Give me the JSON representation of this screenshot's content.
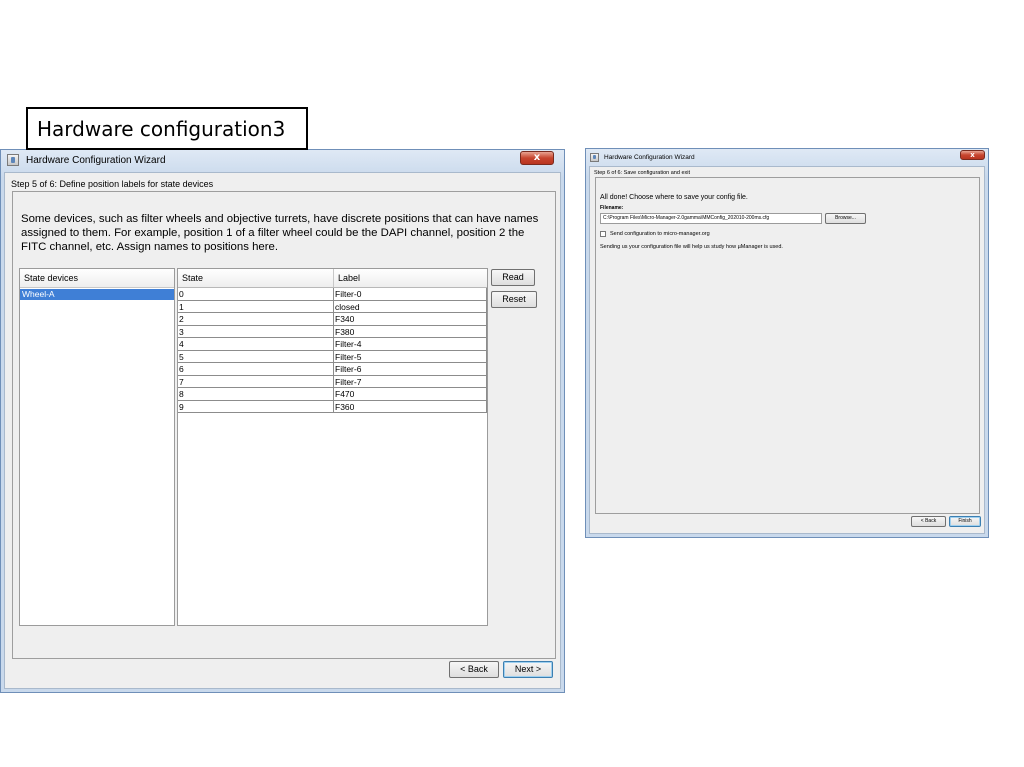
{
  "slide": {
    "title": "Hardware configuration3"
  },
  "left_window": {
    "title": "Hardware Configuration Wizard",
    "close_label": "x",
    "step_label": "Step 5 of 6: Define position labels for state devices",
    "description": "Some devices, such as filter wheels and objective turrets, have discrete positions that can have names assigned to them. For example, position 1 of a filter wheel could be the DAPI channel, position 2 the FITC channel, etc. Assign names to positions here.",
    "devices_header": "State devices",
    "devices": [
      {
        "label": "Wheel-A",
        "selected": true
      }
    ],
    "table": {
      "columns": [
        "State",
        "Label"
      ],
      "rows": [
        {
          "state": "0",
          "label": "Filter-0"
        },
        {
          "state": "1",
          "label": "closed"
        },
        {
          "state": "2",
          "label": "F340"
        },
        {
          "state": "3",
          "label": "F380"
        },
        {
          "state": "4",
          "label": "Filter-4"
        },
        {
          "state": "5",
          "label": "Filter-5"
        },
        {
          "state": "6",
          "label": "Filter-6"
        },
        {
          "state": "7",
          "label": "Filter-7"
        },
        {
          "state": "8",
          "label": "F470"
        },
        {
          "state": "9",
          "label": "F360"
        }
      ]
    },
    "buttons": {
      "read": "Read",
      "reset": "Reset",
      "back": "< Back",
      "next": "Next >"
    }
  },
  "right_window": {
    "title": "Hardware Configuration Wizard",
    "close_label": "x",
    "step_label": "Step 6 of 6: Save configuration and exit",
    "heading": "All done! Choose where to save your config file.",
    "filename_label": "Filename:",
    "filename_value": "C:\\Program Files\\Micro-Manager-2.0gamma\\MMConfig_202010-200ms.cfg",
    "browse_label": "Browse...",
    "send_config_label": "Send configuration to micro-manager.org",
    "send_config_checked": false,
    "note": "Sending us your configuration file will help us study how µManager is used.",
    "buttons": {
      "back": "< Back",
      "finish": "Finish"
    }
  }
}
